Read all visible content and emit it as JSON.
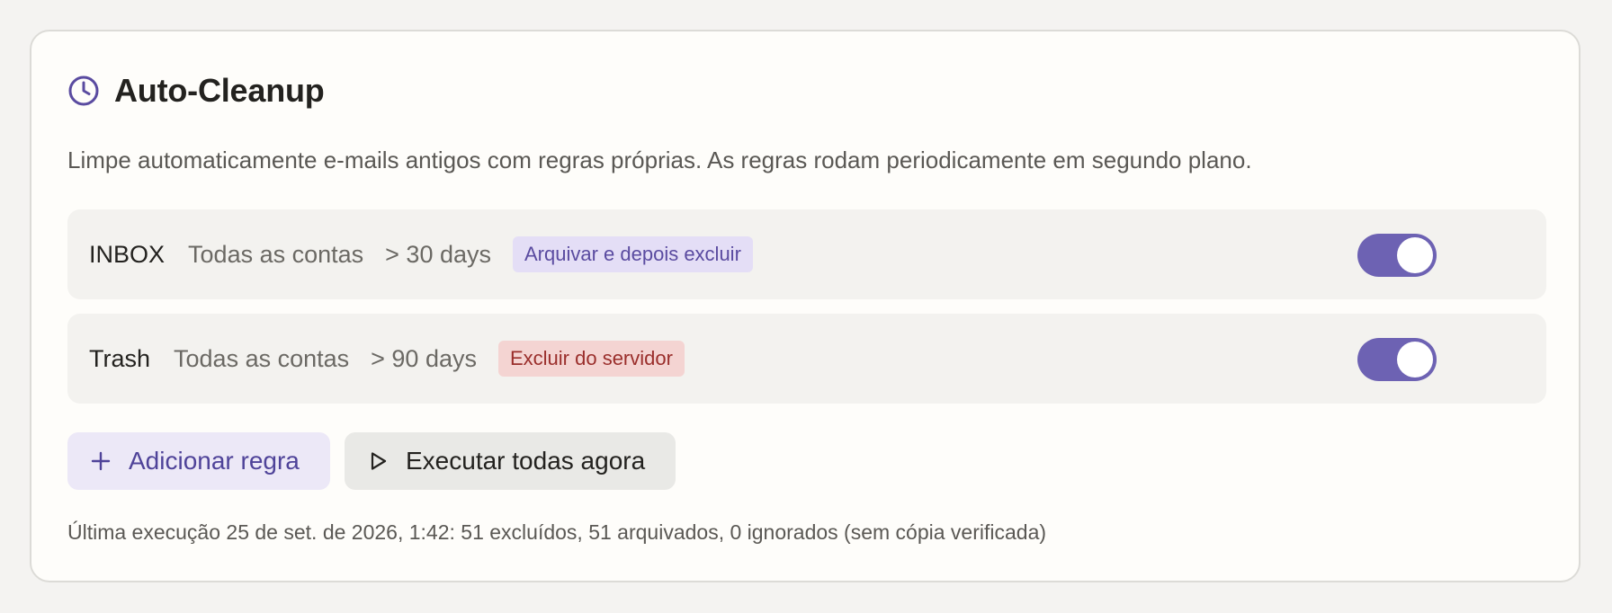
{
  "header": {
    "icon": "clock-icon",
    "title": "Auto-Cleanup"
  },
  "description": "Limpe automaticamente e-mails antigos com regras próprias. As regras rodam periodicamente em segundo plano.",
  "rules": [
    {
      "folder": "INBOX",
      "scope": "Todas as contas",
      "age": "> 30 days",
      "action": "Arquivar e depois excluir",
      "action_color": "#e4def6",
      "enabled": true
    },
    {
      "folder": "Trash",
      "scope": "Todas as contas",
      "age": "> 90 days",
      "action": "Excluir do servidor",
      "action_color": "#f4d4d2",
      "enabled": true
    }
  ],
  "actions": {
    "add_label": "Adicionar regra",
    "add_icon": "plus-icon",
    "run_label": "Executar todas agora",
    "run_icon": "play-icon"
  },
  "last_run": "Última execução 25 de set. de 2026, 1:42: 51 excluídos, 51 arquivados, 0 ignorados (sem cópia verificada)",
  "colors": {
    "accent": "#6d62b3",
    "card_bg": "#fefdfa",
    "page_bg": "#f4f3f1"
  }
}
